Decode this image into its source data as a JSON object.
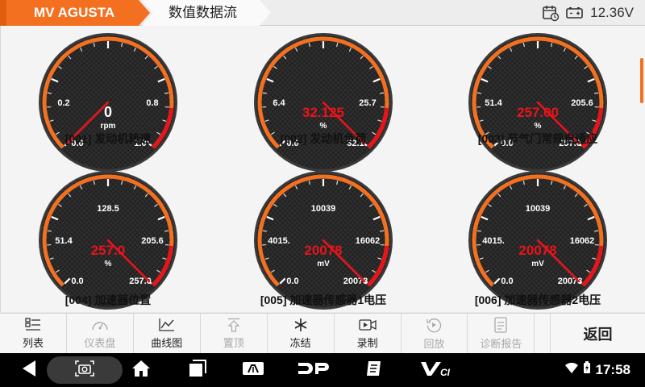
{
  "header": {
    "brand": "MV AGUSTA",
    "title": "数值数据流",
    "battery_voltage": "12.36V"
  },
  "gauges": [
    {
      "code": "[001] 发动机转速",
      "value": "0",
      "unit": "rpm",
      "min": "0.0",
      "max": "1.0",
      "tick_low": "0.2",
      "tick_high": "0.8",
      "needle_fraction": 0.0
    },
    {
      "code": "[002] 发动机负荷",
      "value": "32.125",
      "unit": "%",
      "min": "0.0",
      "max": "32.1",
      "tick_low": "6.4",
      "tick_high": "25.7",
      "needle_fraction": 1.0
    },
    {
      "code": "[003] 节气门常规自适应",
      "value": "257.00",
      "unit": "%",
      "min": "0.0",
      "max": "257.0",
      "tick_low": "51.4",
      "tick_high": "205.6",
      "needle_fraction": 1.0
    },
    {
      "code": "[004] 加速器位置",
      "value": "257.0",
      "unit": "%",
      "min": "0.0",
      "max": "257.0",
      "tick_low": "51.4",
      "tick_high": "205.6",
      "tick_top": "128.5",
      "needle_fraction": 1.0
    },
    {
      "code": "[005] 加速器传感器1电压",
      "value": "20078",
      "unit": "mV",
      "min": "0.0",
      "max": "20078",
      "tick_low": "4015.",
      "tick_high": "16062",
      "tick_top": "10039",
      "needle_fraction": 1.0
    },
    {
      "code": "[006] 加速器传感器2电压",
      "value": "20078",
      "unit": "mV",
      "min": "0.0",
      "max": "20078",
      "tick_low": "4015.",
      "tick_high": "16062",
      "tick_top": "10039",
      "needle_fraction": 1.0
    }
  ],
  "toolbar": {
    "list": "列表",
    "dashboard": "仪表盘",
    "graph": "曲线图",
    "top": "置顶",
    "freeze": "冻结",
    "record": "录制",
    "playback": "回放",
    "report": "诊断报告",
    "back": "返回"
  },
  "navbar": {
    "time": "17:58"
  },
  "colors": {
    "accent": "#f37021",
    "value_red": "#e8141b",
    "gauge_face": "#1f1f1f"
  }
}
